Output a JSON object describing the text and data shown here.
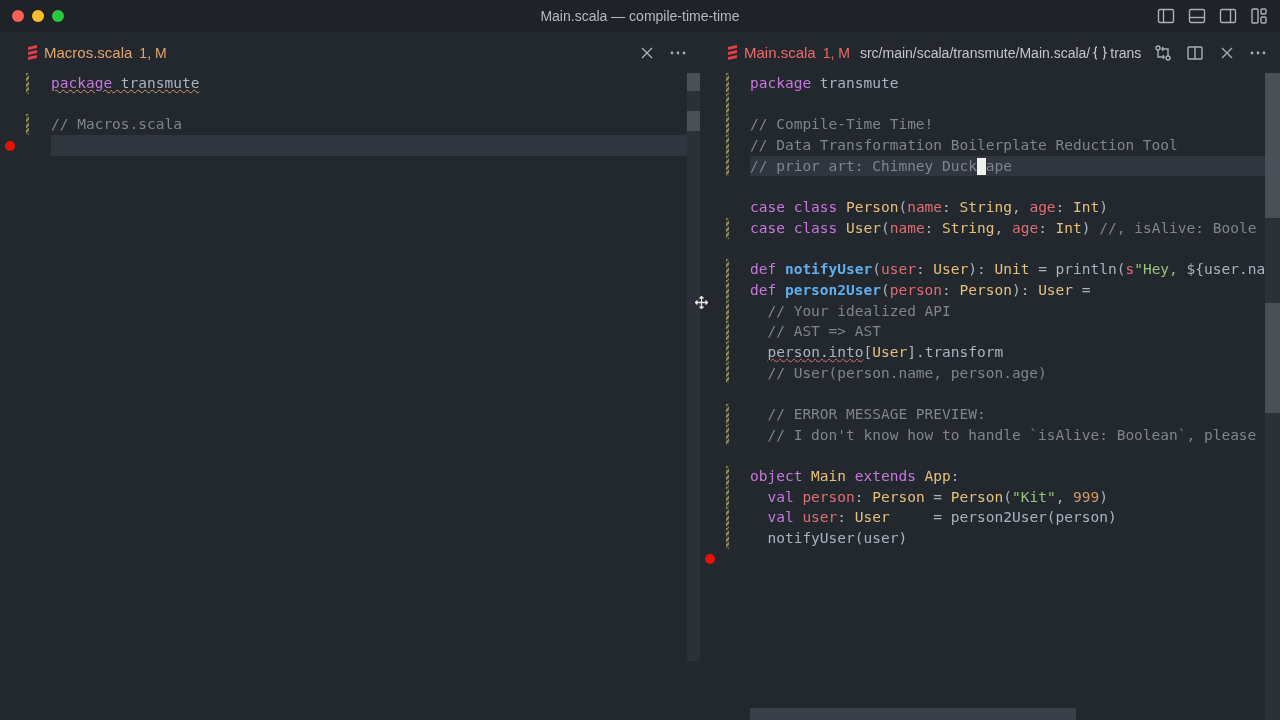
{
  "window": {
    "title": "Main.scala — compile-time-time"
  },
  "editor_groups": [
    {
      "tab": {
        "title": "Macros.scala",
        "status": "1, M",
        "errors": false
      },
      "lines": [
        {
          "modified": true,
          "breakpoint": false,
          "current": false,
          "tokens": [
            {
              "kind": "keyword",
              "text": "package",
              "warning": true
            },
            {
              "kind": "plain",
              "text": " transmute",
              "warning": true
            }
          ]
        },
        {
          "modified": false,
          "breakpoint": false,
          "current": false
        },
        {
          "modified": true,
          "breakpoint": false,
          "current": false,
          "tokens": [
            {
              "kind": "comment",
              "text": "// Macros.scala"
            }
          ]
        },
        {
          "modified": false,
          "breakpoint": true,
          "current": true
        }
      ]
    },
    {
      "tab": {
        "title": "Main.scala",
        "status": "1, M",
        "errors": true
      },
      "breadcrumb": {
        "path": "src/main/scala/transmute/Main.scala/",
        "symbol": "trans"
      },
      "lines": [
        {
          "modified": true,
          "breakpoint": false,
          "current": false,
          "tokens": [
            {
              "kind": "keyword",
              "text": "package"
            },
            {
              "kind": "plain",
              "text": " transmute"
            }
          ]
        },
        {
          "modified": true,
          "breakpoint": false,
          "current": false
        },
        {
          "modified": true,
          "breakpoint": false,
          "current": false,
          "tokens": [
            {
              "kind": "comment",
              "text": "// Compile-Time Time!"
            }
          ]
        },
        {
          "modified": true,
          "breakpoint": false,
          "current": false,
          "tokens": [
            {
              "kind": "comment",
              "text": "// Data Transformation Boilerplate Reduction Tool"
            }
          ]
        },
        {
          "modified": true,
          "breakpoint": false,
          "current": true,
          "tokens": [
            {
              "kind": "comment",
              "text": "// prior art: Chimney Duck"
            },
            {
              "kind": "cursor"
            },
            {
              "kind": "comment",
              "text": "ape"
            }
          ]
        },
        {
          "modified": false,
          "breakpoint": false,
          "current": false
        },
        {
          "modified": false,
          "breakpoint": false,
          "current": false,
          "tokens": [
            {
              "kind": "keyword",
              "text": "case class "
            },
            {
              "kind": "type",
              "text": "Person"
            },
            {
              "kind": "plain",
              "text": "("
            },
            {
              "kind": "param",
              "text": "name"
            },
            {
              "kind": "plain",
              "text": ": "
            },
            {
              "kind": "type",
              "text": "String"
            },
            {
              "kind": "plain",
              "text": ", "
            },
            {
              "kind": "param",
              "text": "age"
            },
            {
              "kind": "plain",
              "text": ": "
            },
            {
              "kind": "type",
              "text": "Int"
            },
            {
              "kind": "plain",
              "text": ")"
            }
          ]
        },
        {
          "modified": true,
          "breakpoint": false,
          "current": false,
          "tokens": [
            {
              "kind": "keyword",
              "text": "case class "
            },
            {
              "kind": "type",
              "text": "User"
            },
            {
              "kind": "plain",
              "text": "("
            },
            {
              "kind": "param",
              "text": "name"
            },
            {
              "kind": "plain",
              "text": ": "
            },
            {
              "kind": "type",
              "text": "String"
            },
            {
              "kind": "plain",
              "text": ", "
            },
            {
              "kind": "param",
              "text": "age"
            },
            {
              "kind": "plain",
              "text": ": "
            },
            {
              "kind": "type",
              "text": "Int"
            },
            {
              "kind": "plain",
              "text": ")"
            },
            {
              "kind": "comment",
              "text": " //, isAlive: Boole"
            }
          ]
        },
        {
          "modified": false,
          "breakpoint": false,
          "current": false
        },
        {
          "modified": true,
          "breakpoint": false,
          "current": false,
          "tokens": [
            {
              "kind": "keyword",
              "text": "def "
            },
            {
              "kind": "function",
              "text": "notifyUser"
            },
            {
              "kind": "plain",
              "text": "("
            },
            {
              "kind": "param",
              "text": "user"
            },
            {
              "kind": "plain",
              "text": ": "
            },
            {
              "kind": "type",
              "text": "User"
            },
            {
              "kind": "plain",
              "text": "): "
            },
            {
              "kind": "type",
              "text": "Unit"
            },
            {
              "kind": "plain",
              "text": " = println("
            },
            {
              "kind": "param",
              "text": "s"
            },
            {
              "kind": "string",
              "text": "\"Hey, "
            },
            {
              "kind": "plain",
              "text": "${user.na"
            }
          ]
        },
        {
          "modified": true,
          "breakpoint": false,
          "current": false,
          "tokens": [
            {
              "kind": "keyword",
              "text": "def "
            },
            {
              "kind": "function",
              "text": "person2User"
            },
            {
              "kind": "plain",
              "text": "("
            },
            {
              "kind": "param",
              "text": "person"
            },
            {
              "kind": "plain",
              "text": ": "
            },
            {
              "kind": "type",
              "text": "Person"
            },
            {
              "kind": "plain",
              "text": "): "
            },
            {
              "kind": "type",
              "text": "User"
            },
            {
              "kind": "plain",
              "text": " ="
            }
          ]
        },
        {
          "modified": true,
          "breakpoint": false,
          "current": false,
          "tokens": [
            {
              "kind": "comment",
              "text": "  // Your idealized API"
            }
          ]
        },
        {
          "modified": true,
          "breakpoint": false,
          "current": false,
          "tokens": [
            {
              "kind": "comment",
              "text": "  // AST => AST"
            }
          ]
        },
        {
          "modified": true,
          "breakpoint": false,
          "current": false,
          "indented": true,
          "tokens": [
            {
              "kind": "plain",
              "text": "person.into",
              "error": true
            },
            {
              "kind": "plain",
              "text": "["
            },
            {
              "kind": "type",
              "text": "User"
            },
            {
              "kind": "plain",
              "text": "].transform"
            }
          ]
        },
        {
          "modified": true,
          "breakpoint": false,
          "current": false,
          "tokens": [
            {
              "kind": "comment",
              "text": "  // User(person.name, person.age)"
            }
          ]
        },
        {
          "modified": false,
          "breakpoint": false,
          "current": false
        },
        {
          "modified": true,
          "breakpoint": false,
          "current": false,
          "tokens": [
            {
              "kind": "comment",
              "text": "  // ERROR MESSAGE PREVIEW:"
            }
          ]
        },
        {
          "modified": true,
          "breakpoint": false,
          "current": false,
          "tokens": [
            {
              "kind": "comment",
              "text": "  // I don't know how to handle `isAlive: Boolean`, please"
            }
          ]
        },
        {
          "modified": false,
          "breakpoint": false,
          "current": false
        },
        {
          "modified": true,
          "breakpoint": false,
          "current": false,
          "tokens": [
            {
              "kind": "keyword",
              "text": "object "
            },
            {
              "kind": "type",
              "text": "Main"
            },
            {
              "kind": "keyword",
              "text": " extends "
            },
            {
              "kind": "type",
              "text": "App"
            },
            {
              "kind": "plain",
              "text": ":"
            }
          ]
        },
        {
          "modified": true,
          "breakpoint": false,
          "current": false,
          "tokens": [
            {
              "kind": "keyword",
              "text": "  val "
            },
            {
              "kind": "param",
              "text": "person"
            },
            {
              "kind": "plain",
              "text": ": "
            },
            {
              "kind": "type",
              "text": "Person"
            },
            {
              "kind": "plain",
              "text": " = "
            },
            {
              "kind": "type",
              "text": "Person"
            },
            {
              "kind": "plain",
              "text": "("
            },
            {
              "kind": "string",
              "text": "\"Kit\""
            },
            {
              "kind": "plain",
              "text": ", "
            },
            {
              "kind": "number",
              "text": "999"
            },
            {
              "kind": "plain",
              "text": ")"
            }
          ]
        },
        {
          "modified": true,
          "breakpoint": false,
          "current": false,
          "tokens": [
            {
              "kind": "keyword",
              "text": "  val "
            },
            {
              "kind": "param",
              "text": "user"
            },
            {
              "kind": "plain",
              "text": ": "
            },
            {
              "kind": "type",
              "text": "User"
            },
            {
              "kind": "plain",
              "text": "     = person2User(person)"
            }
          ]
        },
        {
          "modified": true,
          "breakpoint": false,
          "current": false,
          "tokens": [
            {
              "kind": "plain",
              "text": "  notifyUser(user)"
            }
          ]
        },
        {
          "modified": false,
          "breakpoint": true,
          "current": false
        }
      ]
    }
  ]
}
